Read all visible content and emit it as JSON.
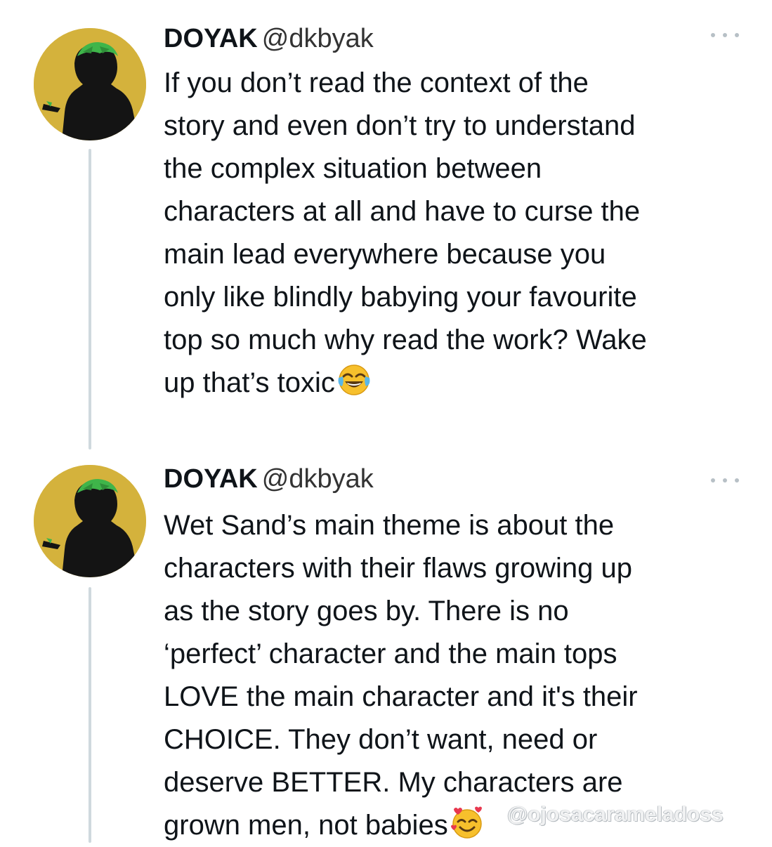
{
  "tweets": [
    {
      "author": {
        "display_name": "DOYAK",
        "handle": "@dkbyak"
      },
      "more_icon": "ellipsis-icon",
      "lines": [
        "If you don’t read the context of the",
        "story and even don’t try to understand",
        "the complex situation between",
        "characters at all and have to curse the",
        "main lead everywhere because you",
        "only like blindly babying your favourite",
        "top so much why read the work? Wake",
        "up that’s toxic"
      ],
      "trailing_emoji": "tears-of-joy-emoji"
    },
    {
      "author": {
        "display_name": "DOYAK",
        "handle": "@dkbyak"
      },
      "more_icon": "ellipsis-icon",
      "lines": [
        "Wet Sand’s main theme is about the",
        "characters with their flaws growing up",
        "as the story goes by. There is no",
        "‘perfect’ character and the main tops",
        "LOVE the main character and it's their",
        "CHOICE. They don’t want, need or",
        "deserve BETTER. My characters are",
        "grown men, not babies"
      ],
      "trailing_emoji": "smiling-face-with-hearts-emoji"
    }
  ],
  "watermark": "@ojosacarameladoss",
  "colors": {
    "avatar_background": "#d4b23c",
    "avatar_hair": "#3fb54a",
    "thread_line": "#cfd9de",
    "text": "#0f1419"
  }
}
